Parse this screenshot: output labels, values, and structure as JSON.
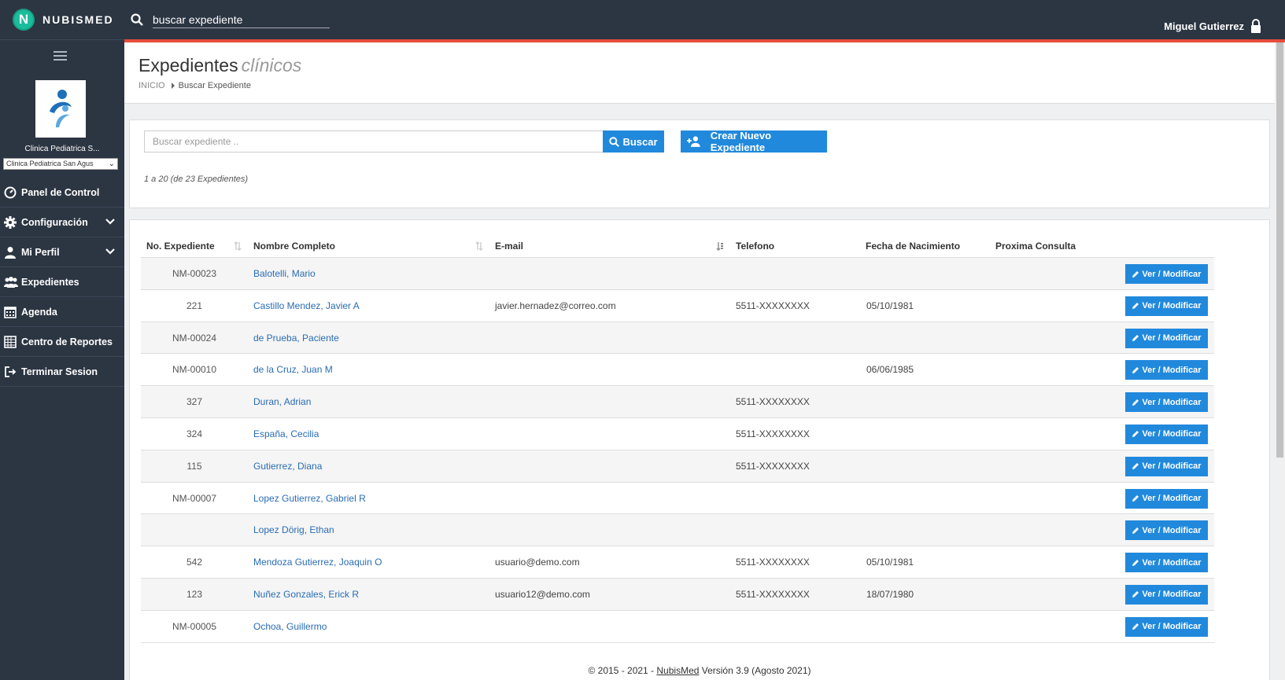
{
  "app": {
    "logo_letter": "N",
    "brand": "NUBISMED",
    "user": "Miguel Gutierrez"
  },
  "topbar": {
    "search_value": "buscar expediente"
  },
  "sidebar": {
    "clinic_name": "Clinica Pediatrica S...",
    "clinic_select": "Clinica Pediatrica San Agus",
    "items": [
      {
        "label": "Panel de Control",
        "icon": "dashboard-icon"
      },
      {
        "label": "Configuración",
        "icon": "gear-icon"
      },
      {
        "label": "Mi Perfil",
        "icon": "user-icon"
      },
      {
        "label": "Expedientes",
        "icon": "users-icon"
      },
      {
        "label": "Agenda",
        "icon": "calendar-icon"
      },
      {
        "label": "Centro de Reportes",
        "icon": "reports-icon"
      },
      {
        "label": "Terminar Sesion",
        "icon": "sign-out-icon"
      }
    ]
  },
  "page": {
    "title": "Expedientes",
    "title_em": "clínicos",
    "breadcrumb_home": "INICIO",
    "breadcrumb_current": "Buscar Expediente"
  },
  "search": {
    "placeholder": "Buscar expediente ..",
    "button": "Buscar",
    "new_button": "Crear Nuevo Expediente",
    "count_text": "1 a 20 (de 23 Expedientes)"
  },
  "table": {
    "headers": [
      "No. Expediente",
      "Nombre Completo",
      "E-mail",
      "Telefono",
      "Fecha de Nacimiento",
      "Proxima Consulta"
    ],
    "action_label": "Ver / Modificar",
    "rows": [
      {
        "no": "NM-00023",
        "name": "Balotelli, Mario",
        "email": "",
        "tel": "",
        "birth": ""
      },
      {
        "no": "221",
        "name": "Castillo Mendez, Javier A",
        "email": "javier.hernadez@correo.com",
        "tel": "5511-XXXXXXXX",
        "birth": "05/10/1981"
      },
      {
        "no": "NM-00024",
        "name": "de Prueba, Paciente",
        "email": "",
        "tel": "",
        "birth": ""
      },
      {
        "no": "NM-00010",
        "name": "de la Cruz, Juan M",
        "email": "",
        "tel": "",
        "birth": "06/06/1985"
      },
      {
        "no": "327",
        "name": "Duran, Adrian",
        "email": "",
        "tel": "5511-XXXXXXXX",
        "birth": ""
      },
      {
        "no": "324",
        "name": "España, Cecilia",
        "email": "",
        "tel": "5511-XXXXXXXX",
        "birth": ""
      },
      {
        "no": "115",
        "name": "Gutierrez, Diana",
        "email": "",
        "tel": "5511-XXXXXXXX",
        "birth": ""
      },
      {
        "no": "NM-00007",
        "name": "Lopez Gutierrez, Gabriel R",
        "email": "",
        "tel": "",
        "birth": ""
      },
      {
        "no": "",
        "name": "Lopez Dörig, Ethan",
        "email": "",
        "tel": "",
        "birth": ""
      },
      {
        "no": "542",
        "name": "Mendoza Gutierrez, Joaquin O",
        "email": "usuario@demo.com",
        "tel": "5511-XXXXXXXX",
        "birth": "05/10/1981"
      },
      {
        "no": "123",
        "name": "Nuñez Gonzales, Erick R",
        "email": "usuario12@demo.com",
        "tel": "5511-XXXXXXXX",
        "birth": "18/07/1980"
      },
      {
        "no": "NM-00005",
        "name": "Ochoa, Guillermo",
        "email": "",
        "tel": "",
        "birth": ""
      }
    ]
  },
  "footer": {
    "prefix": "© 2015 - 2021 - ",
    "link": "NubisMed",
    "suffix": " Versión 3.9 (Agosto 2021)"
  },
  "colors": {
    "sidebar": "#2c3542",
    "accent": "#2189dc",
    "alert": "#e74c3c",
    "link": "#2a6db3"
  }
}
